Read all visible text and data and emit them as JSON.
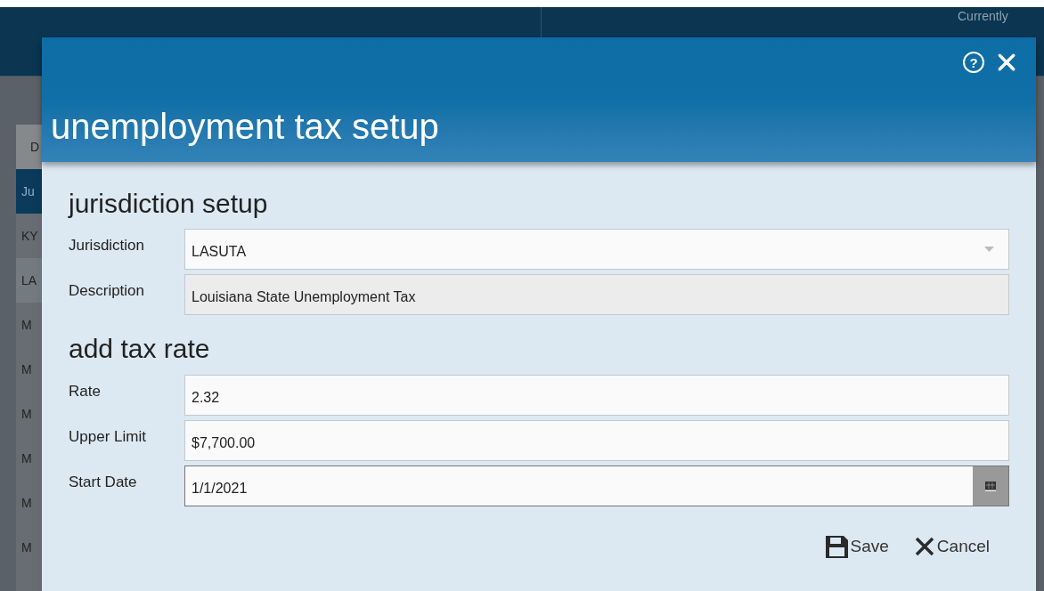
{
  "background": {
    "header_text": "Currently",
    "list_header": "D",
    "rows": [
      {
        "label": "Ju",
        "selected": true
      },
      {
        "label": "KY",
        "selected": false
      },
      {
        "label": "LA",
        "selected": false
      },
      {
        "label": "M",
        "selected": false
      },
      {
        "label": "M",
        "selected": false
      },
      {
        "label": "M",
        "selected": false
      },
      {
        "label": "M",
        "selected": false
      },
      {
        "label": "M",
        "selected": false
      },
      {
        "label": "M",
        "selected": false
      }
    ]
  },
  "dialog": {
    "title": "unemployment tax setup",
    "help": "?",
    "sections": [
      {
        "heading": "jurisdiction setup",
        "fields": [
          {
            "label": "Jurisdiction",
            "value": "LASUTA",
            "kind": "dropdown",
            "disabled": false
          },
          {
            "label": "Description",
            "value": "Louisiana State Unemployment Tax",
            "kind": "text",
            "disabled": true
          }
        ]
      },
      {
        "heading": "add tax rate",
        "fields": [
          {
            "label": "Rate",
            "value": "2.32",
            "kind": "text",
            "disabled": false
          },
          {
            "label": "Upper Limit",
            "value": "$7,700.00",
            "kind": "text",
            "disabled": false
          },
          {
            "label": "Start Date",
            "value": "1/1/2021",
            "kind": "date",
            "disabled": false
          }
        ]
      }
    ],
    "buttons": [
      {
        "label": "Save",
        "kind": "save"
      },
      {
        "label": "Cancel",
        "kind": "cancel"
      }
    ]
  }
}
